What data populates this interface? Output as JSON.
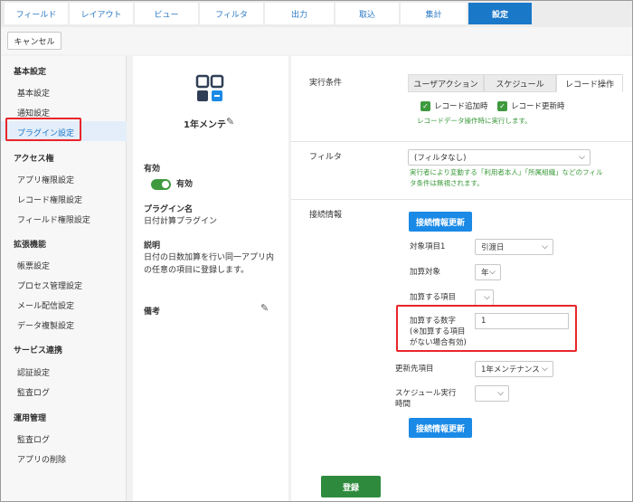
{
  "tabs": [
    "フィールド",
    "レイアウト",
    "ビュー",
    "フィルタ",
    "出力",
    "取込",
    "集計",
    "設定"
  ],
  "toolbar": {
    "cancel_label": "キャンセル"
  },
  "sidebar": {
    "basic_heading": "基本設定",
    "basic_items": [
      "基本設定",
      "通知設定",
      "プラグイン設定"
    ],
    "access_heading": "アクセス権",
    "access_items": [
      "アプリ権限設定",
      "レコード権限設定",
      "フィールド権限設定"
    ],
    "ext_heading": "拡張機能",
    "ext_items": [
      "帳票設定",
      "プロセス管理設定",
      "メール配信設定",
      "データ複製設定"
    ],
    "service_heading": "サービス連携",
    "service_items": [
      "認証設定",
      "監査ログ"
    ],
    "ops_heading": "運用管理",
    "ops_items": [
      "監査ログ",
      "アプリの削除"
    ]
  },
  "plugin": {
    "title": "1年メンテ",
    "enabled_label": "有効",
    "enabled_value": "有効",
    "name_label": "プラグイン名",
    "name_value": "日付計算プラグイン",
    "desc_label": "説明",
    "desc_line1": "日付の日数加算を行い同一アプリ内",
    "desc_line2": "の任意の項目に登録します。",
    "memo_label": "備考"
  },
  "exec": {
    "label": "実行条件",
    "subtabs": [
      "ユーザアクション",
      "スケジュール",
      "レコード操作"
    ],
    "cb_add": "レコード追加時",
    "cb_update": "レコード更新時",
    "note": "レコードデータ操作時に実行します。"
  },
  "filter": {
    "label": "フィルタ",
    "value": "(フィルタなし)",
    "note_line1": "実行者により変動する「利用者本人」「所属組織」などのフィル",
    "note_line2": "タ条件は無視されます。"
  },
  "conn": {
    "label": "接続情報",
    "refresh_label": "接続情報更新",
    "target_label": "対象項目1",
    "target_value": "引渡日",
    "add_target_label": "加算対象",
    "add_target_value": "年",
    "add_item_label": "加算する項目",
    "add_item_value": "",
    "add_num_line1": "加算する数字",
    "add_num_line2": "(※加算する項目",
    "add_num_line3": "がない場合有効)",
    "add_num_value": "1",
    "dest_label": "更新先項目",
    "dest_value": "1年メンテナンス",
    "sched_line1": "スケジュール実行",
    "sched_line2": "時間",
    "sched_value": "",
    "refresh2_label": "接続情報更新"
  },
  "save_label": "登録",
  "colors": {
    "accent": "#1a78c8",
    "green": "#2e8b3e",
    "highlight": "#e8262b"
  }
}
